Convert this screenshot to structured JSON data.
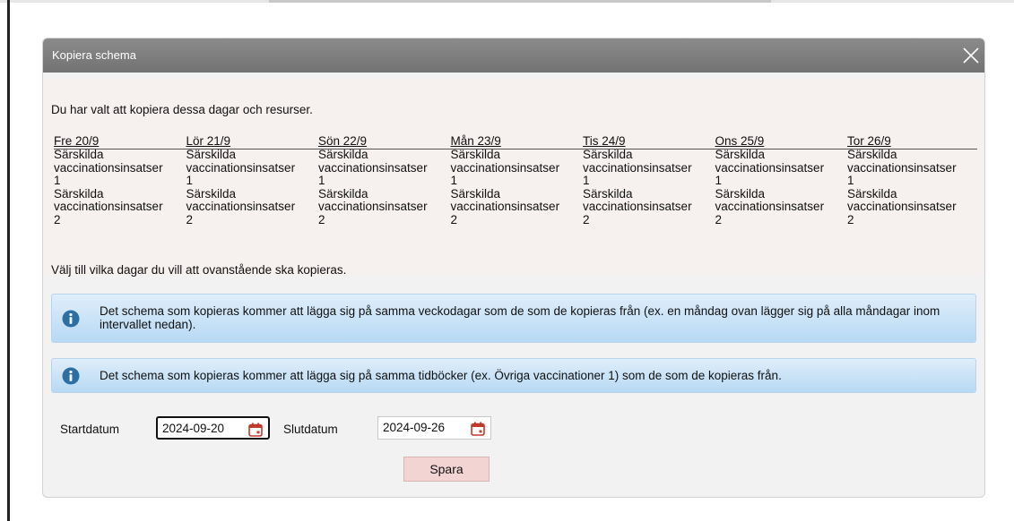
{
  "dialog": {
    "title": "Kopiera schema",
    "close_icon": "close-icon"
  },
  "intro": "Du har valt att kopiera dessa dagar och resurser.",
  "days": [
    {
      "label": "Fre 20/9",
      "resources": [
        [
          "Särskilda",
          "vaccinationsinsatser",
          "1"
        ],
        [
          "Särskilda",
          "vaccinationsinsatser",
          "2"
        ]
      ]
    },
    {
      "label": "Lör 21/9",
      "resources": [
        [
          "Särskilda",
          "vaccinationsinsatser",
          "1"
        ],
        [
          "Särskilda",
          "vaccinationsinsatser",
          "2"
        ]
      ]
    },
    {
      "label": "Sön 22/9",
      "resources": [
        [
          "Särskilda",
          "vaccinationsinsatser",
          "1"
        ],
        [
          "Särskilda",
          "vaccinationsinsatser",
          "2"
        ]
      ]
    },
    {
      "label": "Mån 23/9",
      "resources": [
        [
          "Särskilda",
          "vaccinationsinsatser",
          "1"
        ],
        [
          "Särskilda",
          "vaccinationsinsatser",
          "2"
        ]
      ]
    },
    {
      "label": "Tis 24/9",
      "resources": [
        [
          "Särskilda",
          "vaccinationsinsatser",
          "1"
        ],
        [
          "Särskilda",
          "vaccinationsinsatser",
          "2"
        ]
      ]
    },
    {
      "label": "Ons 25/9",
      "resources": [
        [
          "Särskilda",
          "vaccinationsinsatser",
          "1"
        ],
        [
          "Särskilda",
          "vaccinationsinsatser",
          "2"
        ]
      ]
    },
    {
      "label": "Tor 26/9",
      "resources": [
        [
          "Särskilda",
          "vaccinationsinsatser",
          "1"
        ],
        [
          "Särskilda",
          "vaccinationsinsatser",
          "2"
        ]
      ]
    }
  ],
  "choose_text": "Välj till vilka dagar du vill att ovanstående ska kopieras.",
  "info": [
    {
      "icon": "info-icon",
      "text": "Det schema som kopieras kommer att lägga sig på samma veckodagar som de som de kopieras från (ex. en måndag ovan lägger sig på alla måndagar inom intervallet nedan)."
    },
    {
      "icon": "info-icon",
      "text": "Det schema som kopieras kommer att lägga sig på samma tidböcker (ex. Övriga vaccinationer 1) som de som de kopieras från."
    }
  ],
  "start": {
    "label": "Startdatum",
    "value": "2024-09-20",
    "icon": "calendar-icon"
  },
  "end": {
    "label": "Slutdatum",
    "value": "2024-09-26",
    "icon": "calendar-icon"
  },
  "save_label": "Spara",
  "colors": {
    "title_bar": "#7d7d7d",
    "info_bg": "#c9e3f7",
    "info_icon": "#2e6fa3",
    "calendar": "#c0392b",
    "save_bg": "#f2d4d3"
  }
}
